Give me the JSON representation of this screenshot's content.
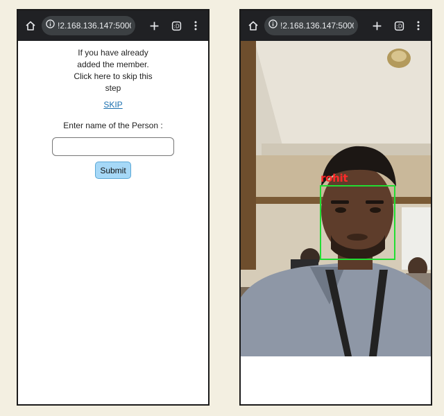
{
  "browser": {
    "url": "!2.168.136.147:5000",
    "home_icon": "home-icon",
    "info_icon": "info-icon",
    "new_tab_icon": "plus-icon",
    "tabs_icon": "tabs-icon",
    "menu_icon": "kebab-menu-icon"
  },
  "left_screen": {
    "message": "If you have already added the member. Click here to skip this step",
    "skip_link": "SKIP",
    "name_label": "Enter name of the Person :",
    "name_input_value": "",
    "submit_label": "Submit"
  },
  "right_screen": {
    "detection_label": "rohit",
    "box_color": "#22dd33",
    "label_color": "#ff2a2a"
  }
}
